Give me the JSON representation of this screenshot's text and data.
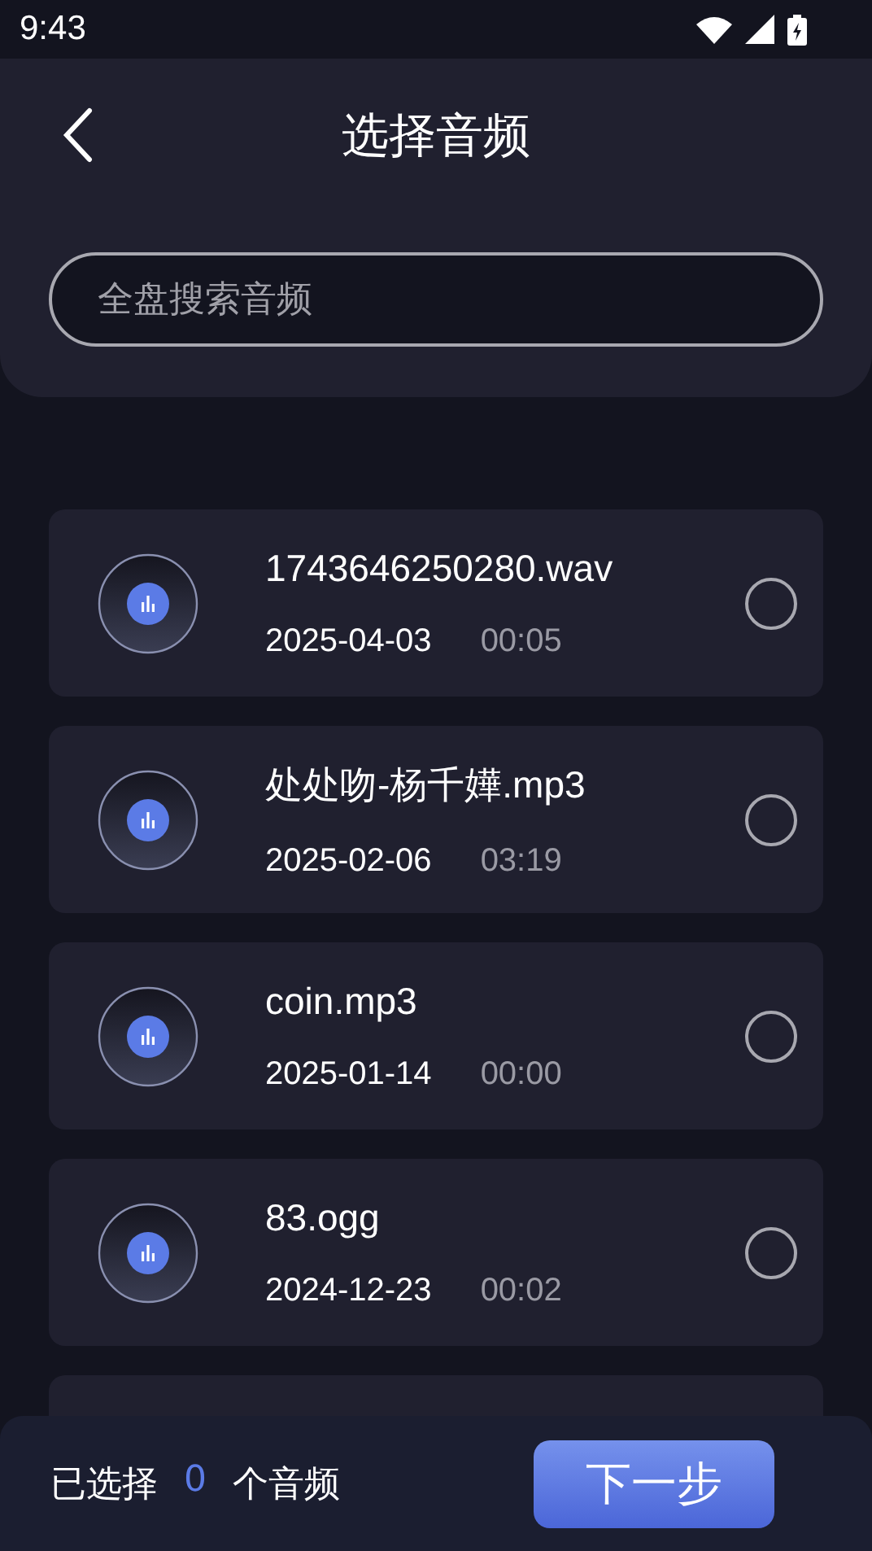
{
  "status_bar": {
    "time": "9:43"
  },
  "header": {
    "title": "选择音频"
  },
  "search": {
    "placeholder": "全盘搜索音频"
  },
  "files": [
    {
      "name": "1743646250280.wav",
      "date": "2025-04-03",
      "duration": "00:05",
      "selected": false
    },
    {
      "name": "处处吻-杨千嬅.mp3",
      "date": "2025-02-06",
      "duration": "03:19",
      "selected": false
    },
    {
      "name": "coin.mp3",
      "date": "2025-01-14",
      "duration": "00:00",
      "selected": false
    },
    {
      "name": "83.ogg",
      "date": "2024-12-23",
      "duration": "00:02",
      "selected": false
    }
  ],
  "footer": {
    "prefix": "已选择",
    "count": "0",
    "suffix": "个音频",
    "button": "下一步"
  }
}
